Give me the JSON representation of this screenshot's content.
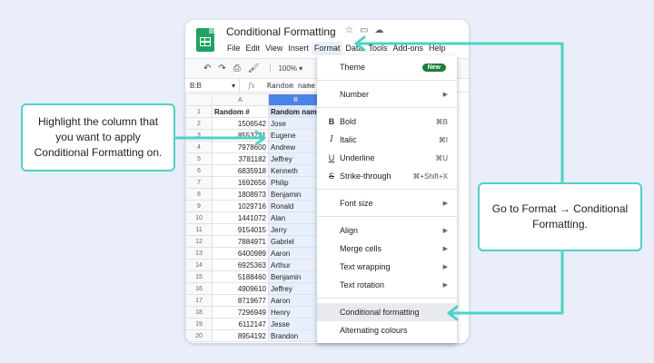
{
  "app": {
    "title": "Conditional Formatting",
    "menus": [
      "File",
      "Edit",
      "View",
      "Insert",
      "Format",
      "Data",
      "Tools",
      "Add-ons",
      "Help"
    ],
    "active_menu": "Format"
  },
  "toolbar": {
    "zoom": "100%"
  },
  "formula_bar": {
    "name_box": "B:B",
    "fx": "fx",
    "value": "Random name"
  },
  "sheet": {
    "columns": [
      "A",
      "B"
    ],
    "rows": [
      {
        "n": "1",
        "a": "Random #",
        "b": "Random name"
      },
      {
        "n": "2",
        "a": "1506542",
        "b": "Jose"
      },
      {
        "n": "3",
        "a": "8553721",
        "b": "Eugene"
      },
      {
        "n": "4",
        "a": "7978600",
        "b": "Andrew"
      },
      {
        "n": "5",
        "a": "3781182",
        "b": "Jeffrey"
      },
      {
        "n": "6",
        "a": "6835918",
        "b": "Kenneth"
      },
      {
        "n": "7",
        "a": "1692656",
        "b": "Philip"
      },
      {
        "n": "8",
        "a": "1808973",
        "b": "Benjamin"
      },
      {
        "n": "9",
        "a": "1029716",
        "b": "Ronald"
      },
      {
        "n": "10",
        "a": "1441072",
        "b": "Alan"
      },
      {
        "n": "11",
        "a": "9154015",
        "b": "Jerry"
      },
      {
        "n": "12",
        "a": "7884971",
        "b": "Gabriel"
      },
      {
        "n": "13",
        "a": "6400989",
        "b": "Aaron"
      },
      {
        "n": "14",
        "a": "6925363",
        "b": "Arthur"
      },
      {
        "n": "15",
        "a": "5188460",
        "b": "Benjamin"
      },
      {
        "n": "16",
        "a": "4909610",
        "b": "Jeffrey"
      },
      {
        "n": "17",
        "a": "8719677",
        "b": "Aaron"
      },
      {
        "n": "18",
        "a": "7296949",
        "b": "Henry"
      },
      {
        "n": "19",
        "a": "6112147",
        "b": "Jesse"
      },
      {
        "n": "20",
        "a": "8954192",
        "b": "Brandon"
      }
    ]
  },
  "format_menu": {
    "theme": "Theme",
    "new_badge": "New",
    "number": "Number",
    "bold": "Bold",
    "bold_sc": "⌘B",
    "italic": "Italic",
    "italic_sc": "⌘I",
    "underline": "Underline",
    "underline_sc": "⌘U",
    "strike": "Strike-through",
    "strike_sc": "⌘+Shift+X",
    "font_size": "Font size",
    "align": "Align",
    "merge": "Merge cells",
    "wrapping": "Text wrapping",
    "rotation": "Text rotation",
    "conditional": "Conditional formatting",
    "alternating": "Alternating colours"
  },
  "callouts": {
    "left": "Highlight the column that you want to apply Conditional Formatting on.",
    "right": "Go to Format → Conditional Formatting."
  },
  "colors": {
    "accent": "#4fd1c5",
    "selected_column": "#4b84e8",
    "sheets_green": "#1ea362"
  }
}
